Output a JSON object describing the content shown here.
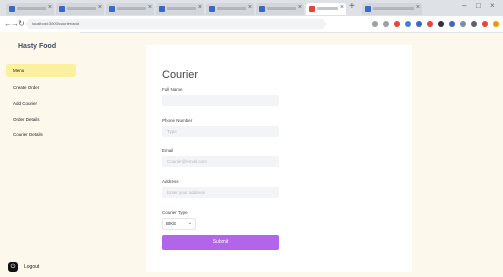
{
  "browser": {
    "tabs": [
      {
        "color": "#3c67c9"
      },
      {
        "color": "#3c67c9"
      },
      {
        "color": "#3c67c9"
      },
      {
        "color": "#3c67c9"
      },
      {
        "color": "#3c67c9"
      },
      {
        "color": "#3c67c9"
      },
      {
        "color": "#ea4335",
        "active": true
      },
      {
        "color": "#3c67c9"
      }
    ],
    "url": "localhost:3000/courier/add"
  },
  "sidebar": {
    "brand": "Hasty Food",
    "items": [
      {
        "label": "Menu",
        "active": true
      },
      {
        "label": "Create Order"
      },
      {
        "label": "Add Courier"
      },
      {
        "label": "Order Details"
      },
      {
        "label": "Courier Details"
      }
    ],
    "logout": {
      "icon": "logout-icon",
      "label": "Logout"
    }
  },
  "form": {
    "title": "Courier",
    "fields": [
      {
        "label": "Full Name",
        "placeholder": ""
      },
      {
        "label": "Phone Number",
        "placeholder": "Type"
      },
      {
        "label": "Email",
        "placeholder": "Courier@email.com"
      },
      {
        "label": "Address",
        "placeholder": "Enter your address"
      }
    ],
    "courier_type_label": "Courier Type",
    "courier_type_value": "BIKE",
    "submit_label": "Submit"
  },
  "colors": {
    "accent": "#b264ea",
    "active_nav": "#faf0a0",
    "background": "#fdf8ec"
  }
}
